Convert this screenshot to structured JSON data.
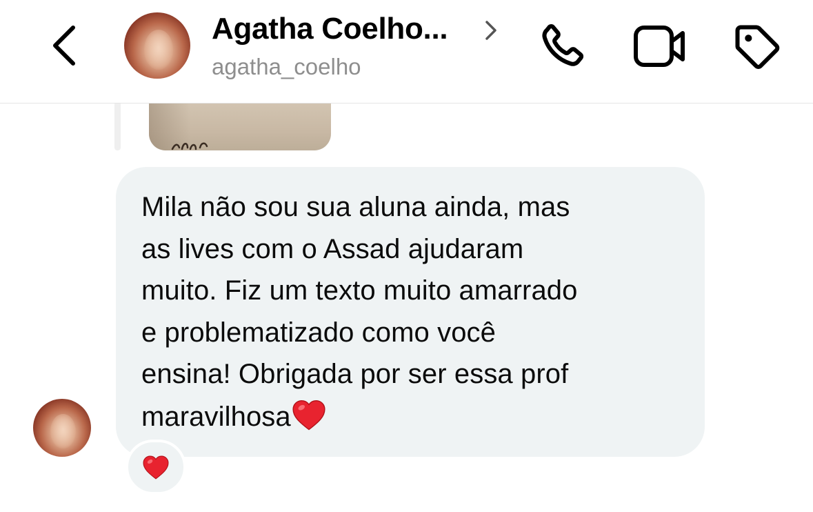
{
  "header": {
    "title": "Agatha Coelho...",
    "username": "agatha_coelho",
    "icons": {
      "back": "chevron-left-icon",
      "title_chevron": "chevron-right-icon",
      "call": "phone-icon",
      "video": "video-camera-icon",
      "label": "tag-icon"
    }
  },
  "conversation": {
    "message": {
      "text": "Mila não sou sua aluna ainda, mas\nas lives com o Assad ajudaram\nmuito. Fiz um texto muito amarrado\ne problematizado como você\nensina! Obrigada por ser essa prof\nmaravilhosa",
      "trailing_emoji": "red-heart-icon",
      "bubble_color": "#eff3f4"
    },
    "reaction": {
      "emoji": "red-heart-icon"
    }
  },
  "colors": {
    "background": "#ffffff",
    "secondary_text": "#8e8e8e",
    "heart": "#e8232f"
  }
}
